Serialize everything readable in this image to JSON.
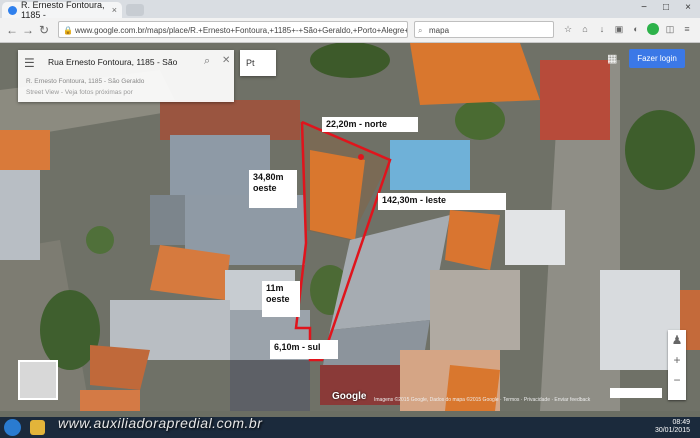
{
  "browser": {
    "tab_title": "R. Ernesto Fontoura, 1185 - ",
    "tab_close": "×",
    "url": "www.google.com.br/maps/place/R.+Ernesto+Fontoura,+1185+-+São+Geraldo,+Porto+Alegre+-+RS,+90230-091/@-30.0",
    "search_value": "mapa",
    "window_buttons": [
      "−",
      "□",
      "×"
    ],
    "nav_icons": [
      "back-icon",
      "forward-icon",
      "reload-icon"
    ]
  },
  "maps": {
    "search_query": "Rua Ernesto Fontoura, 1185 - São",
    "info_line1": "R. Ernesto Fontoura, 1185 - São Geraldo",
    "info_line2": "Street View - Veja fotos próximas por",
    "layer_selector": "Pt",
    "signin_label": "Fazer login",
    "logo": "Google",
    "attribution": "Imagens ©2015 Google, Dados do mapa ©2015 Google · Termos · Privacidade · Enviar feedback"
  },
  "annotations": {
    "north": "22,20m - norte",
    "west_upper_line1": "34,80m",
    "west_upper_line2": "oeste",
    "east": "142,30m - leste",
    "west_lower_line1": "11m",
    "west_lower_line2": "oeste",
    "south": "6,10m - sul"
  },
  "taskbar": {
    "watermark": "www.auxiliadorapredial.com.br",
    "time": "08:49",
    "date": "30/01/2015"
  },
  "colors": {
    "boundary": "#e0141c",
    "signin": "#3b78e7"
  }
}
